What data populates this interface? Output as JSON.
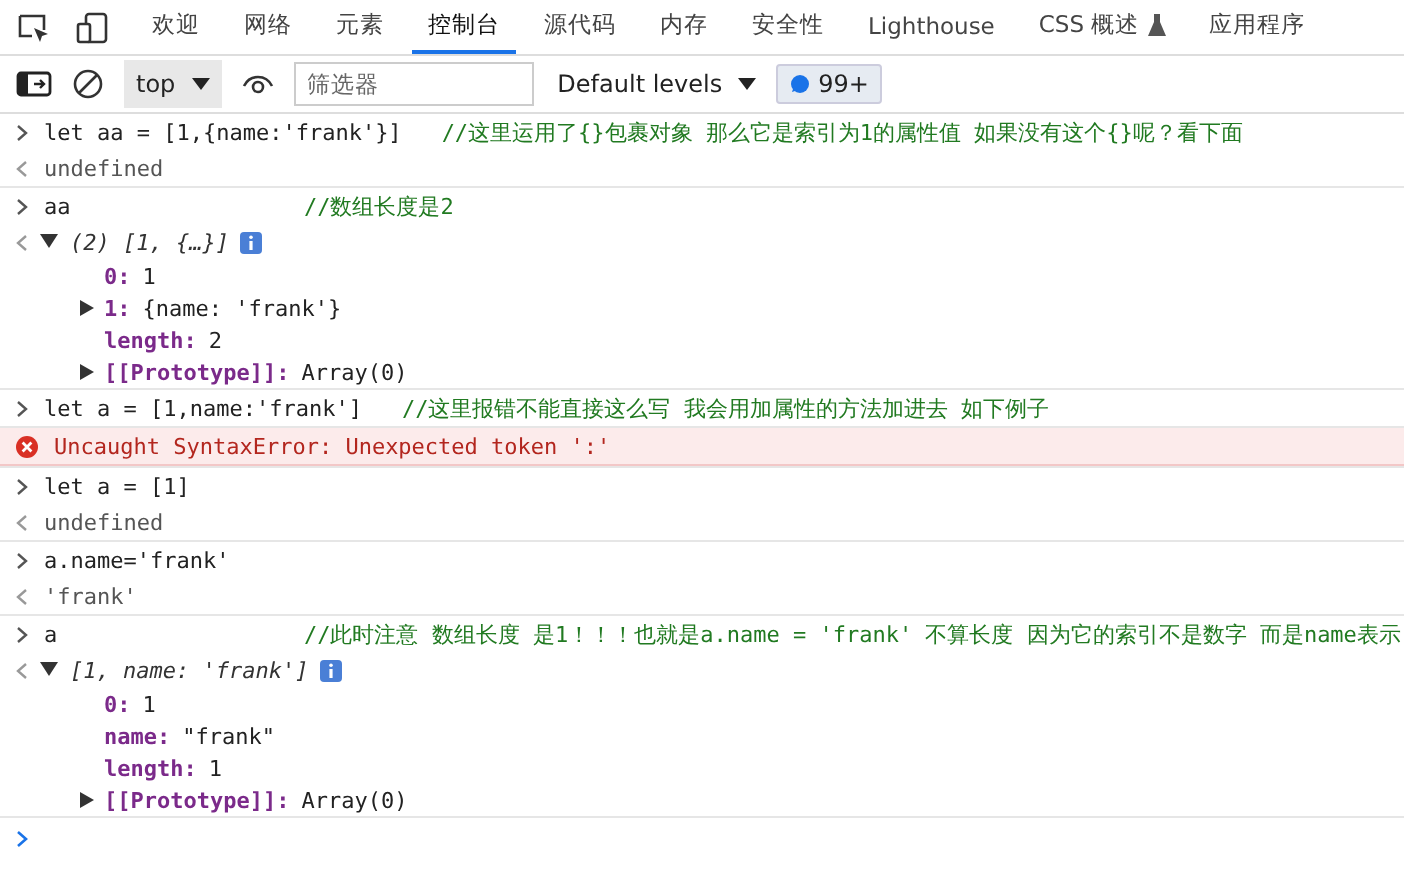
{
  "tabs": [
    {
      "label": "欢迎",
      "selected": false
    },
    {
      "label": "网络",
      "selected": false
    },
    {
      "label": "元素",
      "selected": false
    },
    {
      "label": "控制台",
      "selected": true
    },
    {
      "label": "源代码",
      "selected": false
    },
    {
      "label": "内存",
      "selected": false
    },
    {
      "label": "安全性",
      "selected": false
    },
    {
      "label": "Lighthouse",
      "selected": false
    },
    {
      "label": "CSS 概述",
      "selected": false,
      "kind": "experimental"
    },
    {
      "label": "应用程序",
      "selected": false
    }
  ],
  "toolbar": {
    "context": "top",
    "filter": {
      "placeholder": "筛选器"
    },
    "levels": "Default levels",
    "message_count": "99+"
  },
  "entries": [
    {
      "kind": "input",
      "code": "let aa = [1,{name:'frank'}]",
      "comment": "//这里运用了{}包裹对象 那么它是索引为1的属性值 如果没有这个{}呢？看下面"
    },
    {
      "kind": "result",
      "text": "undefined"
    },
    {
      "kind": "input",
      "code": "aa",
      "comment": "//数组长度是2"
    },
    {
      "kind": "object",
      "summary": "(2) [1, {…}]",
      "expanded": true,
      "properties": [
        {
          "kind": "leaf",
          "key": "0:",
          "value": "1"
        },
        {
          "kind": "collapsed",
          "key": "1:",
          "value": "{name: 'frank'}"
        },
        {
          "kind": "leaf",
          "key": "length:",
          "value": "2"
        },
        {
          "kind": "collapsed",
          "key": "[[Prototype]]:",
          "value": "Array(0)"
        }
      ]
    },
    {
      "kind": "input",
      "code": "let a = [1,name:'frank']",
      "comment": "//这里报错不能直接这么写 我会用加属性的方法加进去 如下例子"
    },
    {
      "kind": "error",
      "text": "Uncaught SyntaxError: Unexpected token ':'"
    },
    {
      "kind": "input",
      "code": "let a = [1]"
    },
    {
      "kind": "result",
      "text": "undefined"
    },
    {
      "kind": "input",
      "code": "a.name='frank'"
    },
    {
      "kind": "result",
      "text": "'frank'"
    },
    {
      "kind": "input",
      "code": "a",
      "comment": "//此时注意 数组长度 是1！！！也就是a.name = 'frank' 不算长度 因为它的索引不是数字 而是name表示"
    },
    {
      "kind": "object",
      "summary": "[1, name: 'frank']",
      "expanded": true,
      "properties": [
        {
          "kind": "leaf",
          "key": "0:",
          "value": "1"
        },
        {
          "kind": "leaf",
          "key": "name:",
          "value": "\"frank\""
        },
        {
          "kind": "leaf",
          "key": "length:",
          "value": "1"
        },
        {
          "kind": "collapsed",
          "key": "[[Prototype]]:",
          "value": "Array(0)"
        }
      ]
    },
    {
      "kind": "prompt"
    }
  ]
}
